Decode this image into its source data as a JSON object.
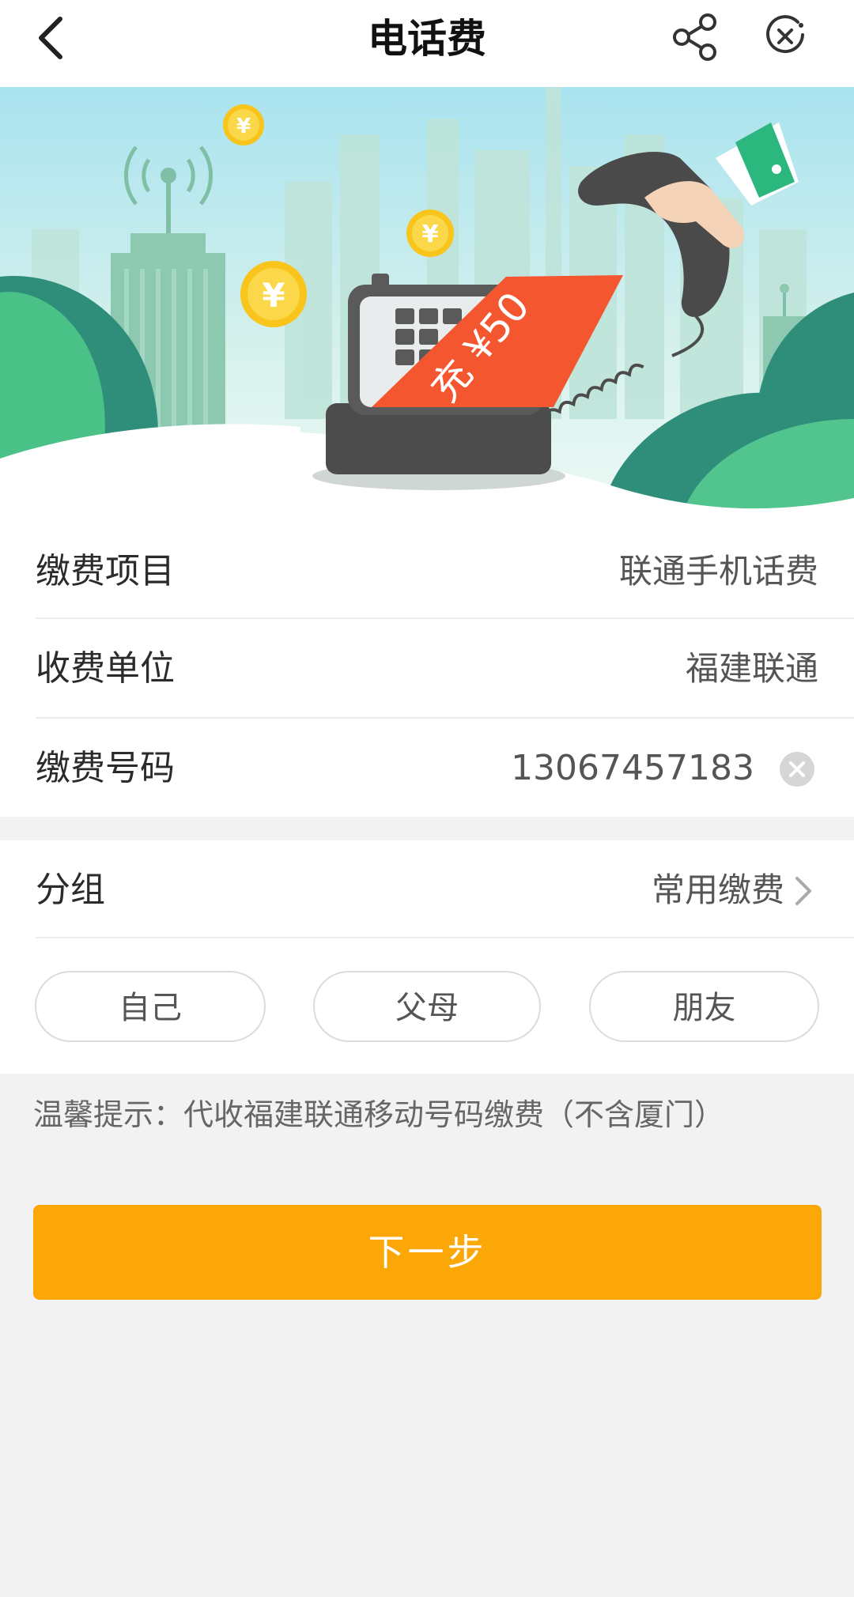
{
  "header": {
    "title": "电话费",
    "back_icon": "chevron-left-icon",
    "share_icon": "share-icon",
    "close_icon": "close-circle-icon"
  },
  "banner": {
    "ticket_text": "充 ¥50",
    "icons": [
      "yen-coin-icon",
      "telephone-icon",
      "signal-tower-icon",
      "hand-receiver-icon"
    ]
  },
  "form": {
    "item": {
      "label": "缴费项目",
      "value": "联通手机话费"
    },
    "payee": {
      "label": "收费单位",
      "value": "福建联通"
    },
    "number": {
      "label": "缴费号码",
      "value": "13067457183"
    }
  },
  "group": {
    "label": "分组",
    "value": "常用缴费",
    "options": [
      "自己",
      "父母",
      "朋友"
    ]
  },
  "tip": "温馨提示：代收福建联通移动号码缴费（不含厦门）",
  "next_button": "下一步",
  "colors": {
    "accent": "#fba707",
    "banner_sky": "#c7ece6",
    "banner_green": "#3fb77e",
    "ticket_red": "#f4562f"
  }
}
